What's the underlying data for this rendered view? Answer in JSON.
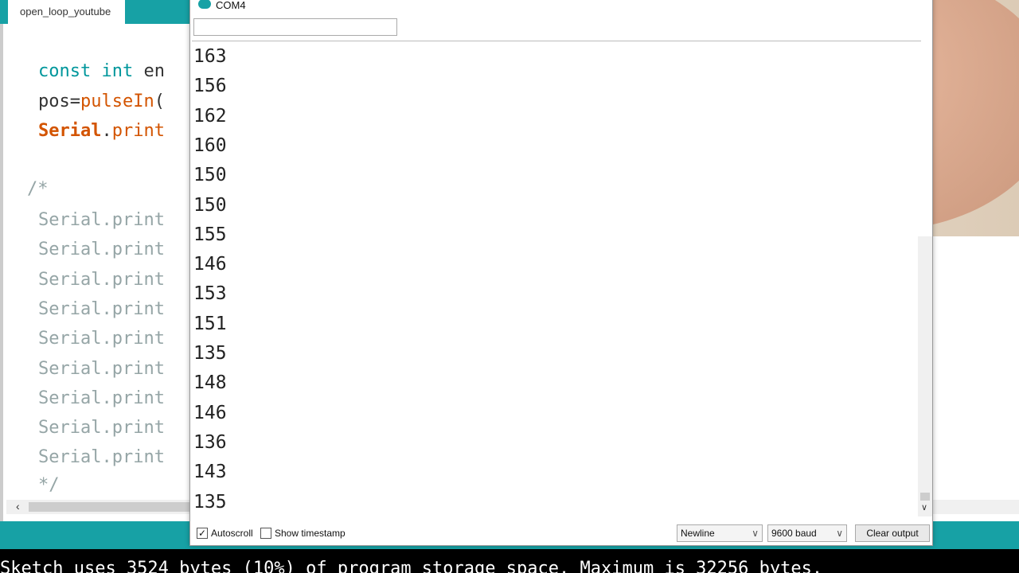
{
  "editor": {
    "tab": "open_loop_youtube",
    "lines": [
      {
        "parts": [
          {
            "t": "const",
            "c": "kw"
          },
          {
            "t": " "
          },
          {
            "t": "int",
            "c": "kw"
          },
          {
            "t": " en"
          }
        ]
      },
      {
        "parts": [
          {
            "t": "pos="
          },
          {
            "t": "pulseIn",
            "c": "fn"
          },
          {
            "t": "("
          }
        ]
      },
      {
        "parts": [
          {
            "t": "Serial",
            "c": "bold"
          },
          {
            "t": "."
          },
          {
            "t": "print",
            "c": "fn"
          }
        ]
      }
    ],
    "comment_open": "/*",
    "comment_lines": [
      "Serial.print",
      "Serial.print",
      "Serial.print",
      "Serial.print",
      "Serial.print",
      "Serial.print",
      "Serial.print",
      "Serial.print",
      "Serial.print"
    ],
    "comment_close": "*/"
  },
  "serial_monitor": {
    "title": "COM4",
    "input_value": "",
    "output": [
      "163",
      "156",
      "162",
      "160",
      "150",
      "150",
      "155",
      "146",
      "153",
      "151",
      "135",
      "148",
      "146",
      "136",
      "143",
      "135"
    ],
    "autoscroll_label": "Autoscroll",
    "autoscroll_checked": true,
    "timestamp_label": "Show timestamp",
    "timestamp_checked": false,
    "line_ending": "Newline",
    "baud": "9600 baud",
    "clear_label": "Clear output"
  },
  "console": {
    "text": "Sketch uses 3524 bytes (10%) of program storage space. Maximum is 32256 bytes."
  },
  "colors": {
    "teal": "#17a1a5",
    "keyword": "#00979c",
    "function": "#d35400"
  }
}
